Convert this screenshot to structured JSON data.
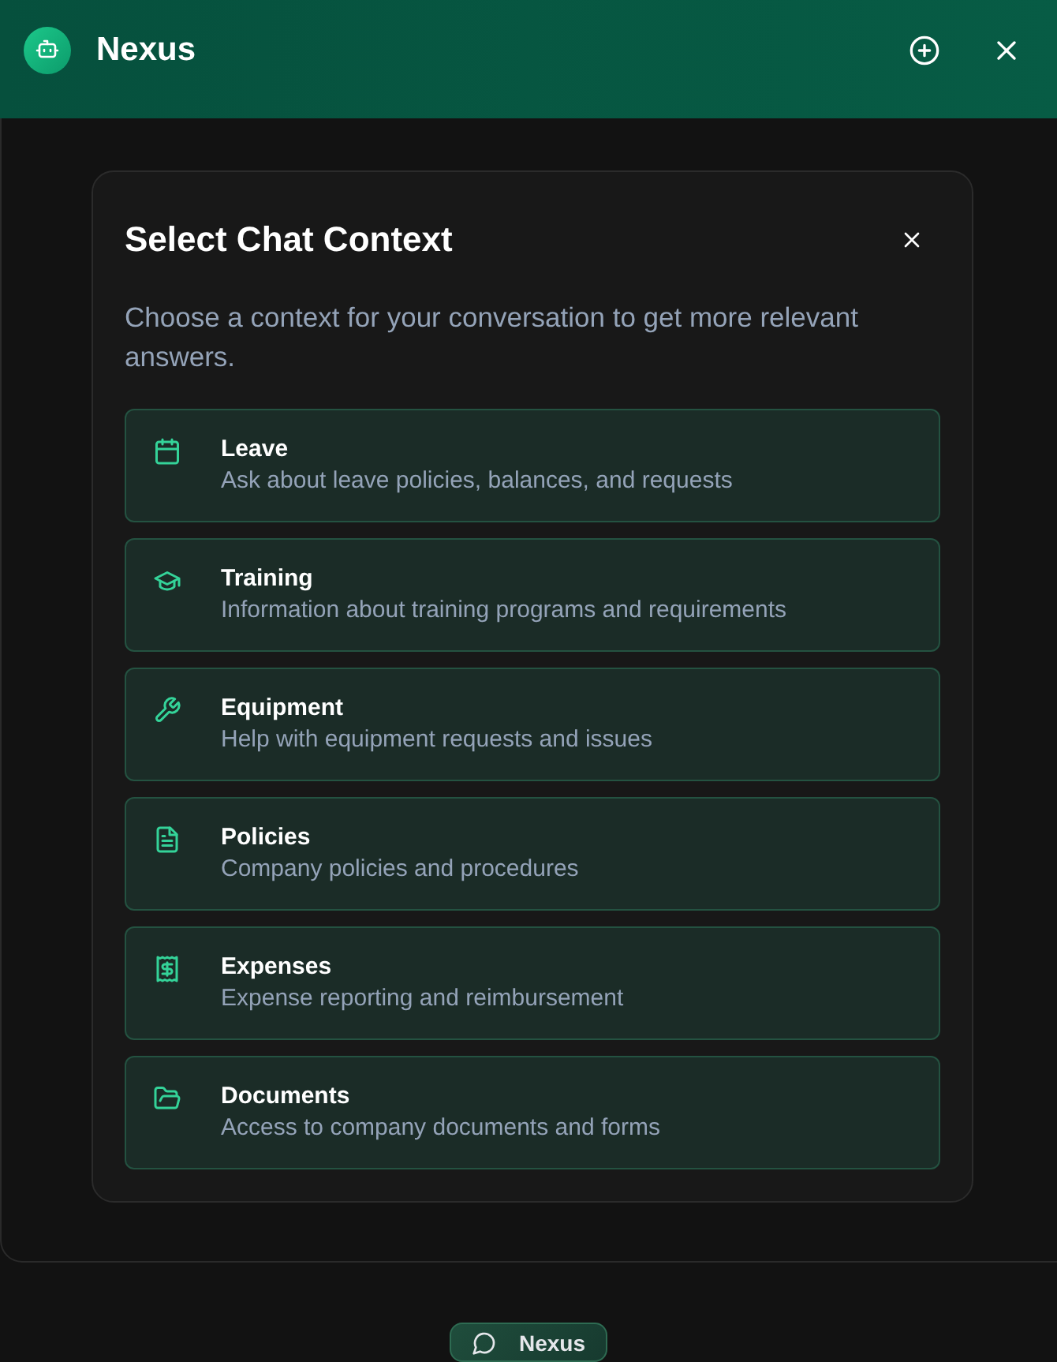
{
  "header": {
    "title": "Nexus"
  },
  "modal": {
    "title": "Select Chat Context",
    "description": "Choose a context for your conversation to get more relevant answers.",
    "contexts": [
      {
        "kind": "leave",
        "title": "Leave",
        "description": "Ask about leave policies, balances, and requests"
      },
      {
        "kind": "training",
        "title": "Training",
        "description": "Information about training programs and requirements"
      },
      {
        "kind": "equipment",
        "title": "Equipment",
        "description": "Help with equipment requests and issues"
      },
      {
        "kind": "policies",
        "title": "Policies",
        "description": "Company policies and procedures"
      },
      {
        "kind": "expenses",
        "title": "Expenses",
        "description": "Expense reporting and reimbursement"
      },
      {
        "kind": "documents",
        "title": "Documents",
        "description": "Access to company documents and forms"
      }
    ]
  },
  "launcher": {
    "label": "Nexus"
  }
}
